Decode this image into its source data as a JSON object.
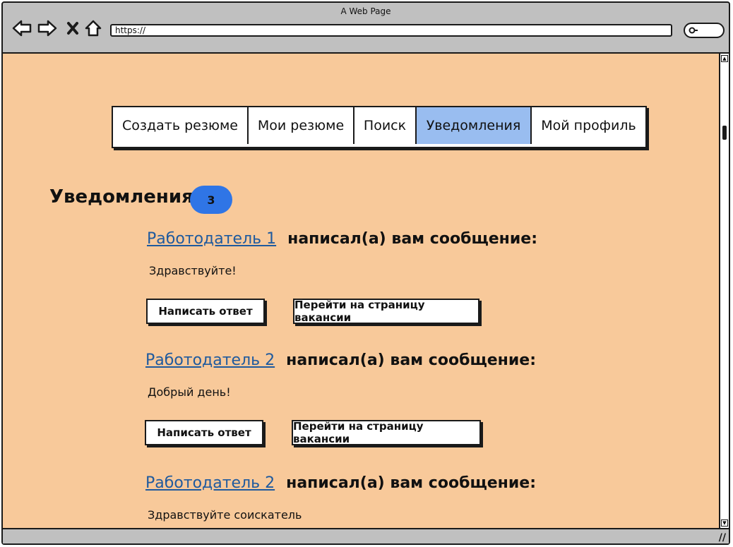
{
  "window": {
    "title": "A Web Page"
  },
  "address_bar": {
    "url": "https://"
  },
  "nav_tabs": [
    {
      "label": "Создать резюме"
    },
    {
      "label": "Мои резюме"
    },
    {
      "label": "Поиск"
    },
    {
      "label": "Уведомления",
      "active": true
    },
    {
      "label": "Мой профиль"
    }
  ],
  "notifications": {
    "title": "Уведомления",
    "count": "3",
    "items": [
      {
        "sender": "Работодатель 1",
        "action_text": "написал(а) вам сообщение:",
        "message": "Здравствуйте!",
        "reply_label": "Написать ответ",
        "vacancy_label": "Перейти на страницу вакансии"
      },
      {
        "sender": "Работодатель 2",
        "action_text": "написал(а) вам сообщение:",
        "message": "Добрый день!",
        "reply_label": "Написать ответ",
        "vacancy_label": "Перейти на страницу вакансии"
      },
      {
        "sender": "Работодатель 2",
        "action_text": "написал(а) вам сообщение:",
        "message": "Здравствуйте соискатель"
      }
    ]
  },
  "colors": {
    "page_bg": "#f8c99a",
    "active_tab": "#99bdf0",
    "badge": "#2f75e6",
    "link": "#1f5a9e"
  }
}
